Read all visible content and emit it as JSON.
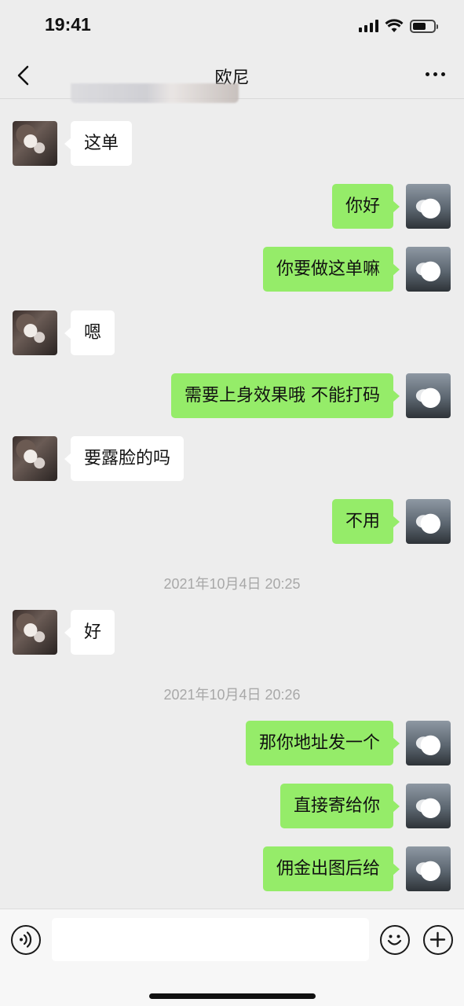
{
  "status_bar": {
    "time": "19:41"
  },
  "nav": {
    "title": "欧尼"
  },
  "messages": [
    {
      "side": "left",
      "text": "这单"
    },
    {
      "side": "right",
      "text": "你好"
    },
    {
      "side": "right",
      "text": "你要做这单嘛"
    },
    {
      "side": "left",
      "text": "嗯"
    },
    {
      "side": "right",
      "text": "需要上身效果哦 不能打码"
    },
    {
      "side": "left",
      "text": "要露脸的吗"
    },
    {
      "side": "right",
      "text": "不用"
    },
    {
      "side": "left",
      "text": "好"
    },
    {
      "side": "right",
      "text": "那你地址发一个"
    },
    {
      "side": "right",
      "text": "直接寄给你"
    },
    {
      "side": "right",
      "text": "佣金出图后给"
    }
  ],
  "timestamps": [
    "2021年10月4日 20:25",
    "2021年10月4日 20:26"
  ],
  "input": {
    "value": "",
    "placeholder": ""
  },
  "icons": {
    "back": "chevron-left-icon",
    "more": "more-dots-icon",
    "voice": "voice-icon",
    "emoji": "emoji-icon",
    "plus": "plus-icon"
  },
  "colors": {
    "background": "#ededed",
    "sent_bubble": "#95ec69",
    "received_bubble": "#ffffff",
    "timestamp_text": "#a8a8a8"
  }
}
